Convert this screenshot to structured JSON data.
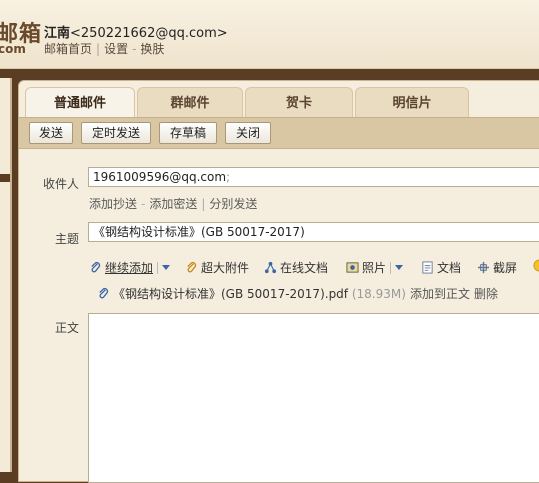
{
  "header": {
    "logo_text": "邮箱",
    "logo_sub": "com",
    "account_name": "江南",
    "account_email": "<250221662@qq.com>",
    "links": [
      "邮箱首页",
      "设置",
      "换肤"
    ]
  },
  "tabs": [
    {
      "label": "普通邮件",
      "active": true
    },
    {
      "label": "群邮件",
      "active": false
    },
    {
      "label": "贺卡",
      "active": false
    },
    {
      "label": "明信片",
      "active": false
    }
  ],
  "toolbar": {
    "send": "发送",
    "scheduled_send": "定时发送",
    "save_draft": "存草稿",
    "close": "关闭"
  },
  "form": {
    "to_label": "收件人",
    "to_value": "1961009596@qq.com",
    "to_suffix": ";",
    "cc_link": "添加抄送",
    "bcc_link": "添加密送",
    "separate_send_link": "分别发送",
    "subject_label": "主题",
    "subject_value": "《钢结构设计标准》(GB 50017-2017)",
    "body_label": "正文"
  },
  "attach_toolbar": {
    "continue_add": "继续添加",
    "large_attachment": "超大附件",
    "online_doc": "在线文档",
    "photo": "照片",
    "document": "文档",
    "screenshot": "截屏"
  },
  "attachment": {
    "file_name": "《钢结构设计标准》(GB 50017-2017).pdf",
    "size": "(18.93M)",
    "add_to_body": "添加到正文",
    "delete": "删除"
  },
  "colors": {
    "frame_brown": "#5a3d22",
    "toolbar_tan": "#d9c7a4",
    "panel_bg": "#f5eedf",
    "link_blue": "#3a66a8"
  }
}
